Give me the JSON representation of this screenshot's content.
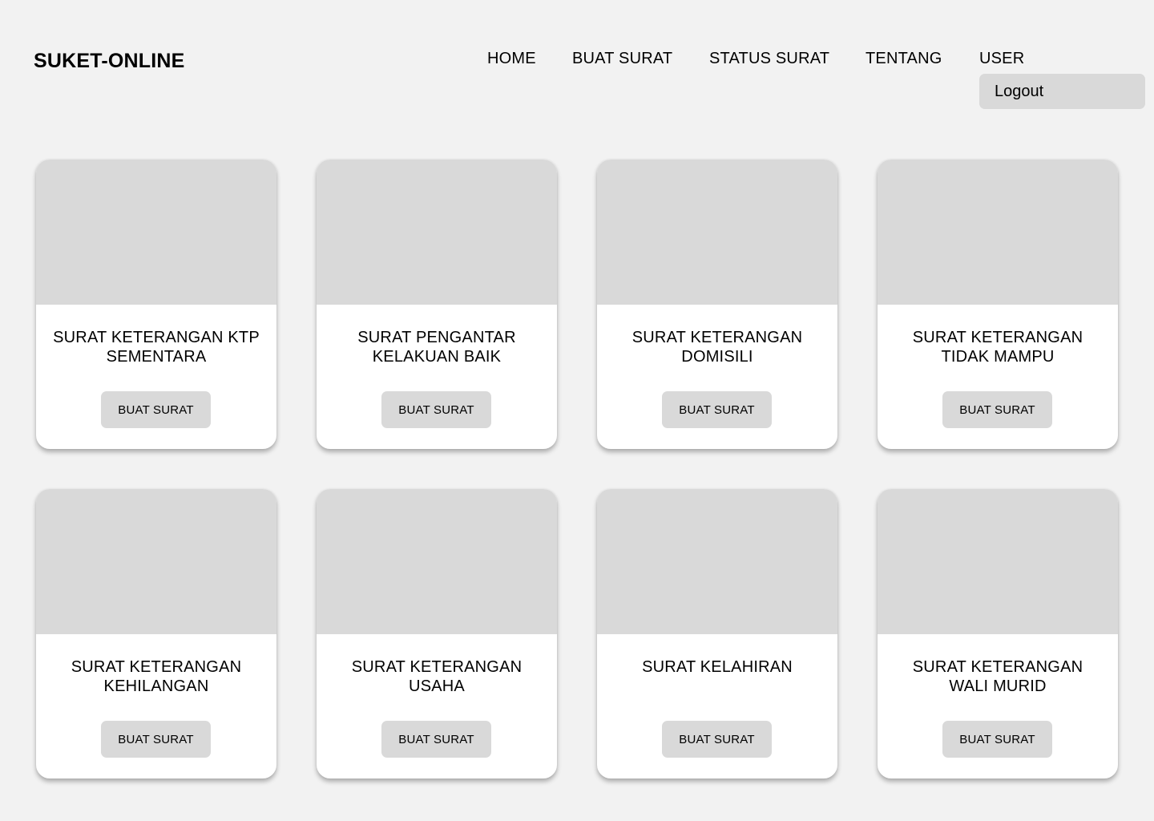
{
  "brand": "SUKET-ONLINE",
  "nav": {
    "home": "HOME",
    "buat_surat": "BUAT SURAT",
    "status_surat": "STATUS SURAT",
    "tentang": "TENTANG",
    "user": "USER"
  },
  "user_menu": {
    "logout": "Logout"
  },
  "cards": [
    {
      "title_line1": "SURAT KETERANGAN KTP",
      "title_line2": "SEMENTARA",
      "button": "BUAT SURAT"
    },
    {
      "title_line1": "SURAT PENGANTAR",
      "title_line2": "KELAKUAN BAIK",
      "button": "BUAT SURAT"
    },
    {
      "title_line1": "SURAT KETERANGAN",
      "title_line2": "DOMISILI",
      "button": "BUAT SURAT"
    },
    {
      "title_line1": "SURAT KETERANGAN",
      "title_line2": "TIDAK MAMPU",
      "button": "BUAT SURAT"
    },
    {
      "title_line1": "SURAT KETERANGAN",
      "title_line2": "KEHILANGAN",
      "button": "BUAT SURAT"
    },
    {
      "title_line1": "SURAT KETERANGAN",
      "title_line2": "USAHA",
      "button": "BUAT SURAT"
    },
    {
      "title_line1": "SURAT KELAHIRAN",
      "title_line2": "",
      "button": "BUAT SURAT"
    },
    {
      "title_line1": "SURAT KETERANGAN",
      "title_line2": "WALI MURID",
      "button": "BUAT SURAT"
    }
  ],
  "colors": {
    "background": "#f2f2f2",
    "placeholder": "#d9d9d9",
    "card": "#ffffff"
  }
}
